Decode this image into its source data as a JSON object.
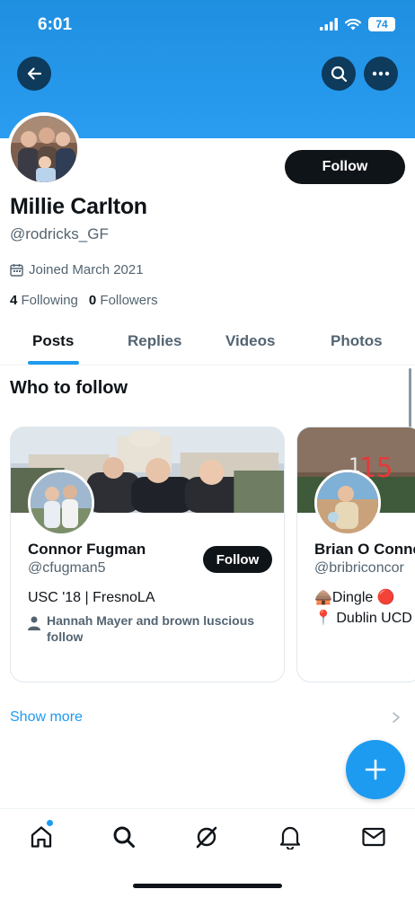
{
  "status_bar": {
    "time": "6:01",
    "battery": "74"
  },
  "profile": {
    "follow_label": "Follow",
    "name": "Millie Carlton",
    "handle": "@rodricks_GF",
    "joined": "Joined March 2021",
    "following_count": "4",
    "following_label": "Following",
    "followers_count": "0",
    "followers_label": "Followers"
  },
  "tabs": [
    {
      "label": "Posts",
      "active": true
    },
    {
      "label": "Replies",
      "active": false
    },
    {
      "label": "Videos",
      "active": false
    },
    {
      "label": "Photos",
      "active": false
    }
  ],
  "who_to_follow": {
    "title": "Who to follow",
    "cards": [
      {
        "name": "Connor Fugman",
        "handle": "@cfugman5",
        "bio": "USC '18 | FresnoLA",
        "follow_label": "Follow",
        "social_context": "Hannah Mayer and brown luscious follow"
      },
      {
        "name": "Brian O Conne",
        "handle": "@bribriconcor",
        "bio_line1": "🛖Dingle 🔴",
        "bio_line2": "📍 Dublin UCD"
      }
    ],
    "show_more": "Show more"
  },
  "colors": {
    "accent": "#1d9bf0",
    "header_blue": "#2a9df1",
    "text_primary": "#0f1419",
    "text_secondary": "#536471"
  },
  "icons": {
    "back": "arrow-left",
    "search": "magnifier",
    "more": "ellipsis",
    "calendar": "calendar",
    "person": "person",
    "compose": "plus",
    "nav": [
      "home",
      "search",
      "grok",
      "bell",
      "envelope"
    ]
  }
}
